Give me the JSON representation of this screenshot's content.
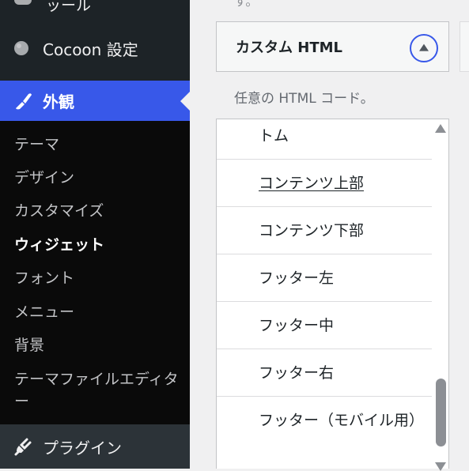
{
  "sidebar": {
    "top_partial_label": "ッール",
    "cocoon_label": "Cocoon 設定",
    "appearance_label": "外観",
    "submenu": [
      "テーマ",
      "デザイン",
      "カスタマイズ",
      "ウィジェット",
      "フォント",
      "メニュー",
      "背景",
      "テーマファイルエディター"
    ],
    "current_submenu": "ウィジェット",
    "plugins_label": "プラグイン"
  },
  "main": {
    "intro_fade": "す。",
    "widget_title": "カスタム HTML",
    "widget_description": "任意の HTML コード。",
    "area_list": [
      "サイドバースクロール追従ボトム",
      "コンテンツ上部",
      "コンテンツ下部",
      "フッター左",
      "フッター中",
      "フッター右",
      "フッター（モバイル用）"
    ],
    "area_list_visible_first": "トム",
    "selected_area": "コンテンツ上部"
  },
  "colors": {
    "accent": "#3858e9",
    "sidebar_bg": "#1d2327",
    "submenu_bg": "#0a0a0a"
  },
  "icons": {
    "cocoon": "cocoon-circle-icon",
    "appearance": "paintbrush-icon",
    "plugins": "plugin-plug-icon",
    "toggle": "chevron-up-icon"
  }
}
